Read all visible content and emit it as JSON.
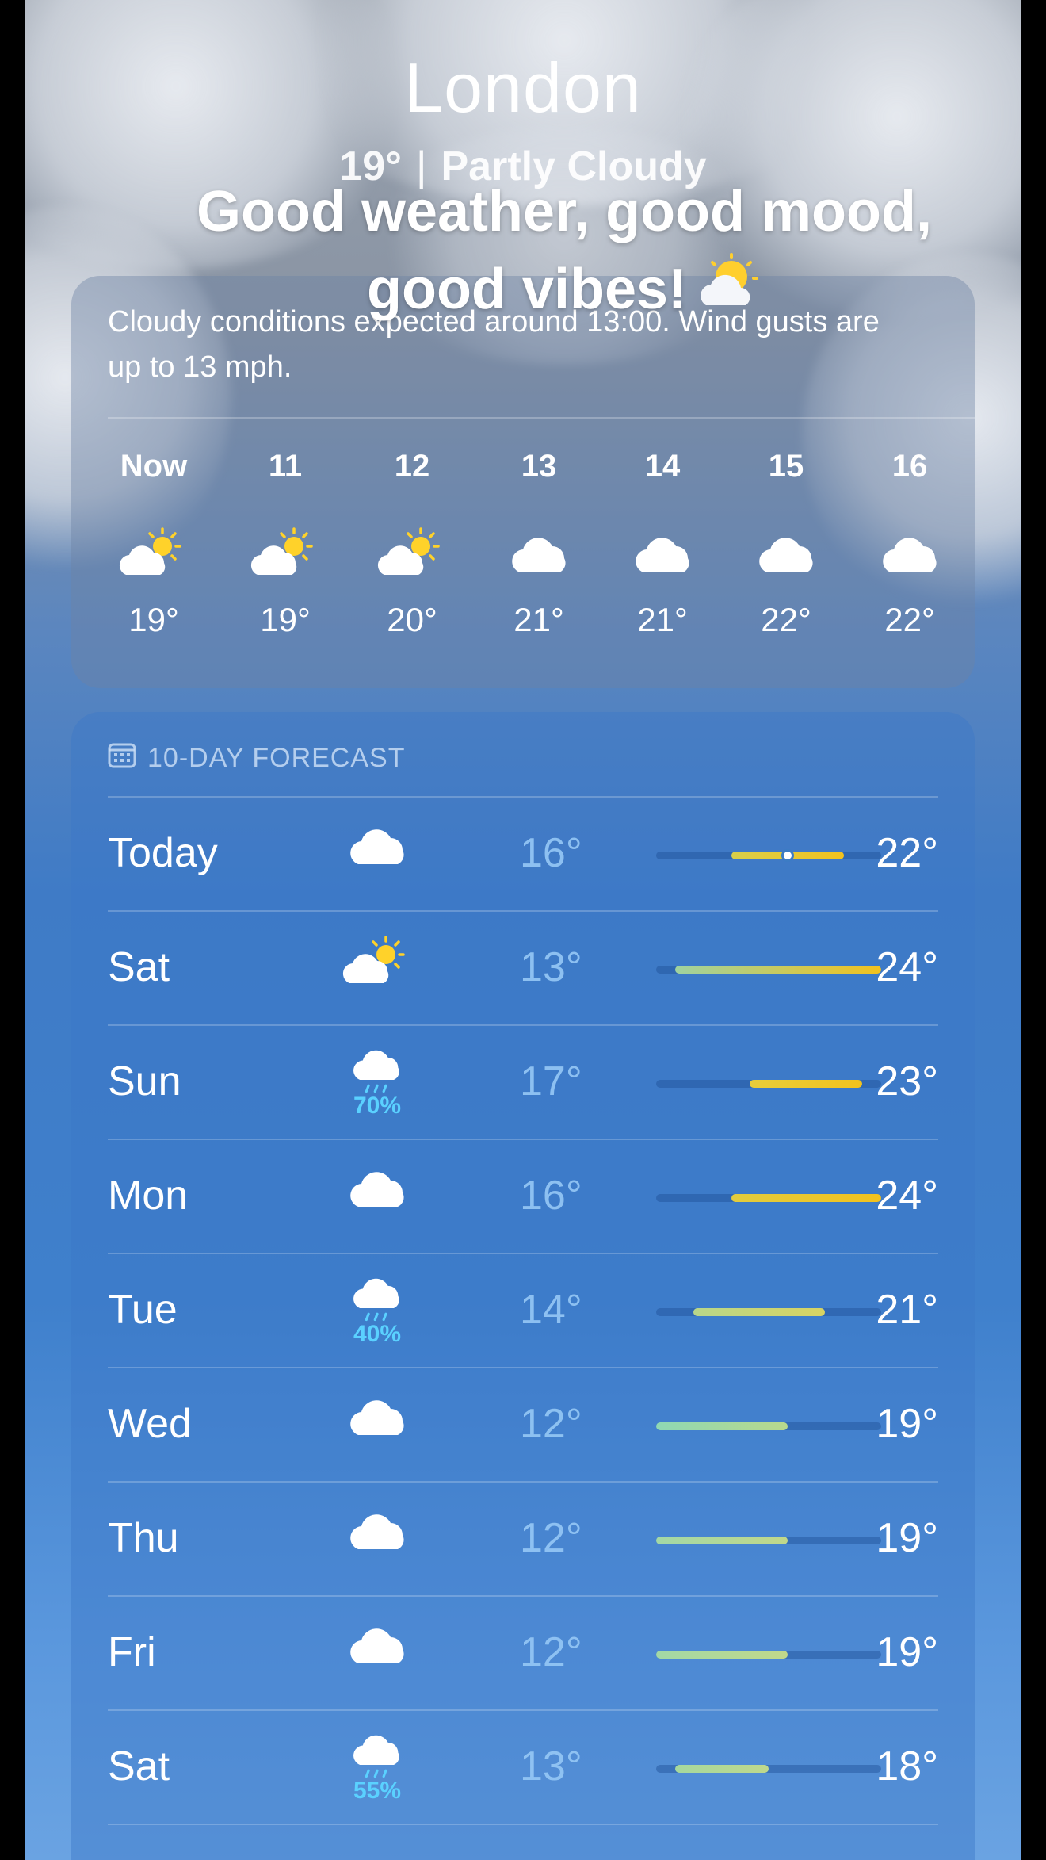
{
  "header": {
    "city": "London",
    "temp": "19°",
    "separator": "|",
    "condition": "Partly Cloudy"
  },
  "overlay_caption": {
    "line1": "Good weather, good mood,",
    "line2": "good vibes!",
    "emoji_icon": "sun-behind-cloud-emoji"
  },
  "hourly": {
    "description": "Cloudy conditions expected around 13:00. Wind gusts are up to 13 mph.",
    "hours": [
      {
        "label": "Now",
        "icon": "partly-cloudy-icon",
        "temp": "19°"
      },
      {
        "label": "11",
        "icon": "partly-cloudy-icon",
        "temp": "19°"
      },
      {
        "label": "12",
        "icon": "partly-cloudy-icon",
        "temp": "20°"
      },
      {
        "label": "13",
        "icon": "cloud-icon",
        "temp": "21°"
      },
      {
        "label": "14",
        "icon": "cloud-icon",
        "temp": "21°"
      },
      {
        "label": "15",
        "icon": "cloud-icon",
        "temp": "22°"
      },
      {
        "label": "16",
        "icon": "cloud-icon",
        "temp": "22°"
      }
    ]
  },
  "forecast": {
    "title": "10-DAY FORECAST",
    "title_icon": "calendar-icon",
    "range_min": 12,
    "range_max": 24,
    "days": [
      {
        "day": "Today",
        "icon": "cloud-icon",
        "precip": "",
        "low": "16°",
        "high": "22°",
        "low_value": 16,
        "high_value": 22,
        "current_value": 19,
        "colors": [
          "#d9cf4a",
          "#f2c21e"
        ]
      },
      {
        "day": "Sat",
        "icon": "partly-cloudy-icon",
        "precip": "",
        "low": "13°",
        "high": "24°",
        "low_value": 13,
        "high_value": 24,
        "colors": [
          "#9fd2a0",
          "#f2c21e"
        ]
      },
      {
        "day": "Sun",
        "icon": "rain-icon",
        "precip": "70%",
        "low": "17°",
        "high": "23°",
        "low_value": 17,
        "high_value": 23,
        "colors": [
          "#e8cd3a",
          "#f2c21e"
        ]
      },
      {
        "day": "Mon",
        "icon": "cloud-icon",
        "precip": "",
        "low": "16°",
        "high": "24°",
        "low_value": 16,
        "high_value": 24,
        "colors": [
          "#e2cc3e",
          "#f2c21e"
        ]
      },
      {
        "day": "Tue",
        "icon": "rain-icon",
        "precip": "40%",
        "low": "14°",
        "high": "21°",
        "low_value": 14,
        "high_value": 21,
        "colors": [
          "#b8d68a",
          "#d8d462"
        ]
      },
      {
        "day": "Wed",
        "icon": "cloud-icon",
        "precip": "",
        "low": "12°",
        "high": "19°",
        "low_value": 12,
        "high_value": 19,
        "colors": [
          "#8fd8b4",
          "#b8d98c"
        ]
      },
      {
        "day": "Thu",
        "icon": "cloud-icon",
        "precip": "",
        "low": "12°",
        "high": "19°",
        "low_value": 12,
        "high_value": 19,
        "colors": [
          "#a3d8a6",
          "#c1d88a"
        ]
      },
      {
        "day": "Fri",
        "icon": "cloud-icon",
        "precip": "",
        "low": "12°",
        "high": "19°",
        "low_value": 12,
        "high_value": 19,
        "colors": [
          "#a3d8a6",
          "#c1d88a"
        ]
      },
      {
        "day": "Sat",
        "icon": "rain-icon",
        "precip": "55%",
        "low": "13°",
        "high": "18°",
        "low_value": 13,
        "high_value": 18,
        "colors": [
          "#a6d89e",
          "#bfd88c"
        ]
      }
    ]
  }
}
